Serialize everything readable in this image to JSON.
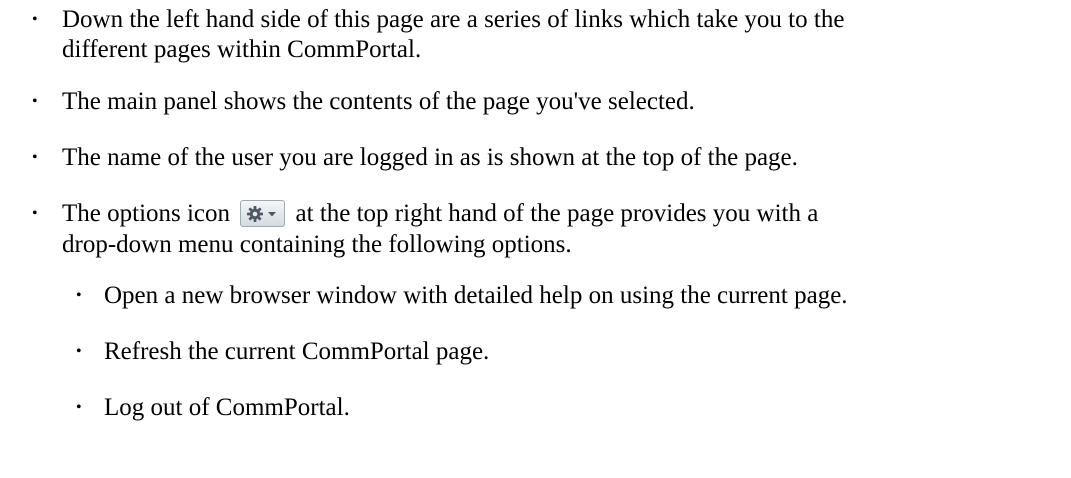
{
  "bullets": [
    {
      "line1": "Down the left hand side of this page are a series of links which take you to the",
      "line2": "different pages within CommPortal."
    },
    {
      "line1": "The main panel shows the contents of the page you've selected."
    },
    {
      "line1": "The name of the user you are logged in as is shown at the top of the page."
    },
    {
      "line1_before_icon": "The options icon",
      "line1_after_icon": "at the top right hand of the page provides you with a",
      "line2": "drop-down menu containing the following options.",
      "icon": "gear-dropdown-icon",
      "subitems": [
        "Open a new browser window with detailed help on using the current page.",
        "Refresh the current CommPortal page.",
        "Log out of CommPortal."
      ]
    }
  ],
  "bullet_glyph": "•"
}
